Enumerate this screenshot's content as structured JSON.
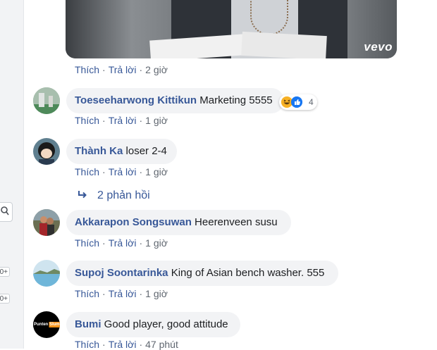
{
  "sidebar": {
    "badges": [
      "0+",
      "0+"
    ]
  },
  "video": {
    "watermark": "vevo"
  },
  "actions": {
    "like": "Thích",
    "reply": "Trả lời",
    "separator": "·"
  },
  "comments": [
    {
      "author": "Toeseeharwong Kittikun",
      "text": "Marketing 5555",
      "time": "1 giờ",
      "reaction_count": "4",
      "reaction_icons": [
        "haha-icon",
        "like-icon"
      ]
    },
    {
      "author": "Thành Ka",
      "text": "loser 2-4",
      "time": "1 giờ",
      "replies_label": "2 phản hồi"
    },
    {
      "author": "Akkarapon Songsuwan",
      "text": "Heerenveen susu",
      "time": "1 giờ"
    },
    {
      "author": "Supoj Soontarinka",
      "text": "King of Asian bench washer. 555",
      "time": "1 giờ"
    },
    {
      "author": "Bumi",
      "text": "Good player, good attitude",
      "time": "47 phút",
      "avatar_text": "Punten Slum"
    }
  ],
  "top_meta": {
    "time": "2 giờ"
  },
  "colors": {
    "link": "#385898",
    "bubble": "#f2f3f5",
    "meta": "#606770",
    "like": "#1877f2",
    "haha": "#f7b125"
  }
}
